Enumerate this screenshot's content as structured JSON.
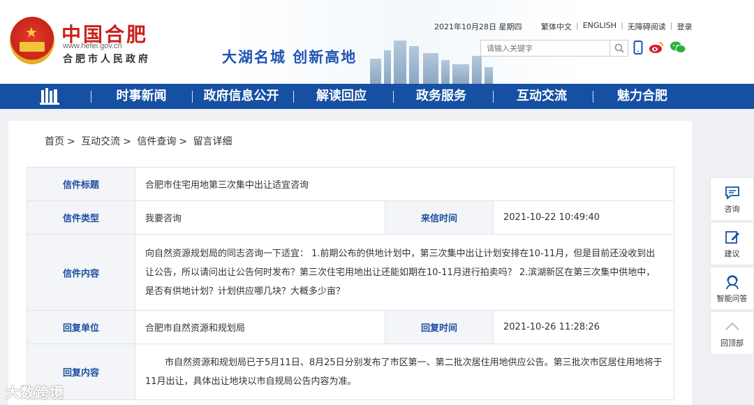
{
  "header": {
    "site_name": "中国合肥",
    "site_url": "www.hefei.gov.cn",
    "site_subtitle": "合肥市人民政府",
    "slogan": "大湖名城  创新高地",
    "date": "2021年10月28日 星期四",
    "links": [
      "繁体中文",
      "ENGLISH",
      "无障碍阅读",
      "登录"
    ],
    "search_placeholder": "请输入关键字"
  },
  "nav": {
    "items": [
      "时事新闻",
      "政府信息公开",
      "解读回应",
      "政务服务",
      "互动交流",
      "魅力合肥"
    ]
  },
  "breadcrumb": [
    "首页",
    "互动交流",
    "信件查询",
    "留言详细"
  ],
  "letter": {
    "title_label": "信件标题",
    "title": "合肥市住宅用地第三次集中出让适宜咨询",
    "type_label": "信件类型",
    "type": "我要咨询",
    "time_label": "来信时间",
    "time": "2021-10-22 10:49:40",
    "content_label": "信件内容",
    "content": "向自然资源规划局的同志咨询一下适宜： 1.前期公布的供地计划中，第三次集中出让计划安排在10-11月，但是目前还没收到出让公告，所以请问出让公告何时发布？第三次住宅用地出让还能如期在10-11月进行拍卖吗？ 2.滨湖新区在第三次集中供地中，是否有供地计划？计划供应哪几块？大概多少亩？",
    "reply_unit_label": "回复单位",
    "reply_unit": "合肥市自然资源和规划局",
    "reply_time_label": "回复时间",
    "reply_time": "2021-10-26 11:28:26",
    "reply_content_label": "回复内容",
    "reply_content": "市自然资源和规划局已于5月11日、8月25日分别发布了市区第一、第二批次居住用地供应公告。第三批次市区居住用地将于11月出让，具体出让地块以市自规局公告内容为准。"
  },
  "sidebar": {
    "items": [
      "咨询",
      "建议",
      "智能问答",
      "回顶部"
    ]
  },
  "watermark": "大数跨境",
  "colors": {
    "nav_blue": "#1650a3",
    "brand_red": "#c9201a",
    "label_blue": "#1b4e9e"
  }
}
